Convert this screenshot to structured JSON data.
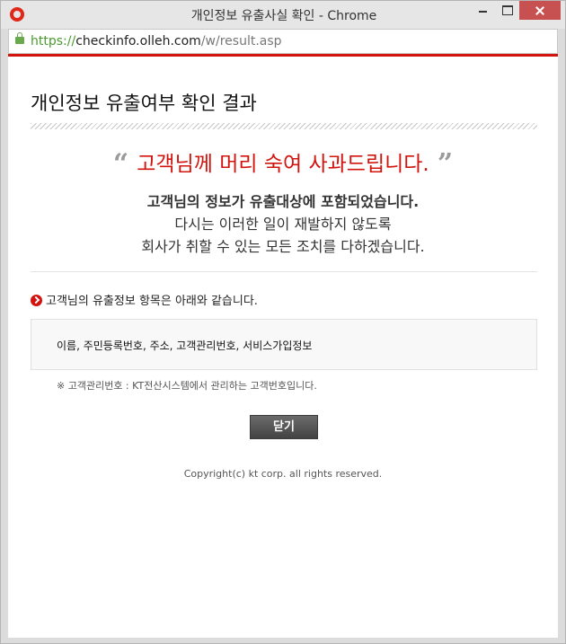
{
  "window": {
    "title": "개인정보 유출사실 확인 - Chrome",
    "accent_color": "#d2140e"
  },
  "address_bar": {
    "scheme": "https://",
    "host": "checkinfo.olleh.com",
    "path": "/w/result.asp"
  },
  "page": {
    "title": "개인정보 유출여부 확인 결과",
    "apology": {
      "open_quote": "“",
      "text": "고객님께 머리 숙여 사과드립니다.",
      "close_quote": "”"
    },
    "message_lines": [
      "고객님의 정보가 유출대상에 포함되었습니다.",
      "다시는 이러한 일이 재발하지 않도록",
      "회사가 취할 수 있는 모든 조치를 다하겠습니다."
    ],
    "items_heading": "고객님의 유출정보 항목은 아래와 같습니다.",
    "items_value": "이름, 주민등록번호, 주소, 고객관리번호, 서비스가입정보",
    "note": "※ 고객관리번호 : KT전산시스템에서 관리하는 고객번호입니다.",
    "close_label": "닫기",
    "copyright": "Copyright(c) kt corp. all rights reserved."
  }
}
